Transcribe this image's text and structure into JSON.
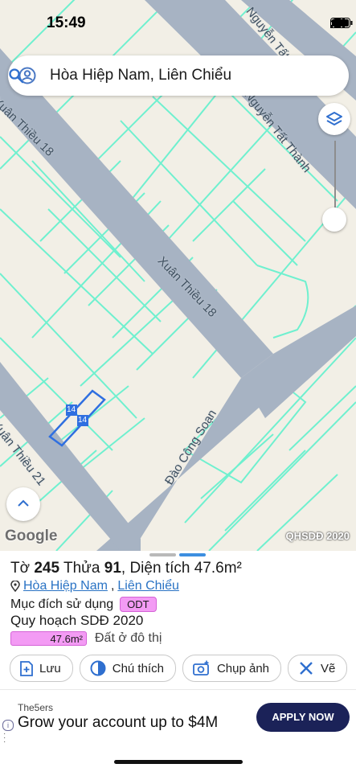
{
  "status_bar": {
    "time": "15:49"
  },
  "search": {
    "query": "Hòa Hiệp Nam, Liên Chiểu"
  },
  "map": {
    "street_labels": [
      "Nguyễn Tất Thành",
      "Nguyễn Tất Thành",
      "Xuân Thiều 18",
      "Xuân Thiều 18",
      "Xuân Thiều 21",
      "Đào Công Soạn"
    ],
    "parcel_labels": [
      "14",
      "14"
    ],
    "attribution": "Google",
    "layer_tag": "QHSDĐ 2020",
    "colors": {
      "background": "#f2efe6",
      "road": "#a7b3c3",
      "parcel_line": "#6ff0cf",
      "selected": "#2f6fe0"
    }
  },
  "sheet": {
    "title_prefix": "Tờ",
    "sheet_no": "245",
    "parcel_word": "Thửa",
    "parcel_no": "91",
    "area_text": "Diện tích 47.6m²",
    "location_ward": "Hòa Hiệp Nam",
    "location_sep": ",",
    "location_district": "Liên Chiểu",
    "usage_label": "Mục đích sử dụng",
    "usage_badge": "ODT",
    "plan_label": "Quy hoạch SDĐ 2020",
    "plan_area": "47.6m²",
    "plan_type": "Đất ở đô thị",
    "actions": [
      "Lưu",
      "Chú thích",
      "Chụp ảnh",
      "Vẽ"
    ]
  },
  "ad": {
    "brand": "The5ers",
    "headline": "Grow your account up to $4M",
    "cta": "APPLY NOW"
  }
}
